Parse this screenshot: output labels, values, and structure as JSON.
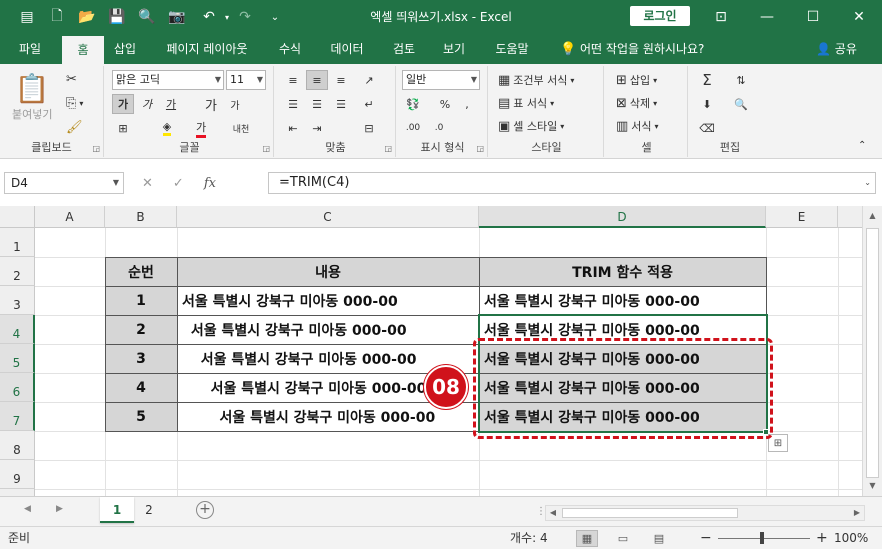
{
  "titlebar": {
    "title": "엑셀 띄워쓰기.xlsx  -  Excel",
    "login": "로그인"
  },
  "tabs": [
    "파일",
    "홈",
    "삽입",
    "페이지 레이아웃",
    "수식",
    "데이터",
    "검토",
    "보기",
    "도움말"
  ],
  "active_tab": "홈",
  "tell_me": "어떤 작업을 원하시나요?",
  "share": "공유",
  "ribbon": {
    "clipboard": {
      "label": "클립보드",
      "paste": "붙여넣기"
    },
    "font": {
      "label": "글꼴",
      "font_name": "맑은 고딕",
      "font_size": "11"
    },
    "alignment": {
      "label": "맞춤"
    },
    "number": {
      "label": "표시 형식",
      "format": "일반"
    },
    "styles": {
      "label": "스타일",
      "conditional": "조건부 서식",
      "table": "표 서식",
      "cell": "셀 스타일"
    },
    "cells": {
      "label": "셀",
      "insert": "삽입",
      "delete": "삭제",
      "format": "서식"
    },
    "editing": {
      "label": "편집"
    }
  },
  "formula_bar": {
    "name_box": "D4",
    "formula": "=TRIM(C4)"
  },
  "columns": [
    "A",
    "B",
    "C",
    "D",
    "E"
  ],
  "rows": [
    "1",
    "2",
    "3",
    "4",
    "5",
    "6",
    "7",
    "8",
    "9"
  ],
  "table": {
    "headers": [
      "순번",
      "내용",
      "TRIM 함수 적용"
    ],
    "rows": [
      {
        "num": "1",
        "content": "서울 특별시 강북구 미아동 000-00",
        "trim": "서울 특별시 강북구 미아동 000-00"
      },
      {
        "num": "2",
        "content": " 서울 특별시 강북구 미아동 000-00",
        "trim": "서울 특별시 강북구 미아동 000-00"
      },
      {
        "num": "3",
        "content": "  서울 특별시 강북구 미아동 000-00",
        "trim": "서울 특별시 강북구 미아동 000-00"
      },
      {
        "num": "4",
        "content": "   서울 특별시 강북구 미아동 000-00",
        "trim": "서울 특별시 강북구 미아동 000-00"
      },
      {
        "num": "5",
        "content": "    서울 특별시 강북구 미아동 000-00",
        "trim": "서울 특별시 강북구 미아동 000-00"
      }
    ]
  },
  "callout": "08",
  "sheets": [
    "1",
    "2"
  ],
  "active_sheet": "1",
  "status": {
    "mode": "준비",
    "count": "개수: 4",
    "zoom": "100%"
  },
  "colors": {
    "accent": "#217346",
    "highlight": "#d0121b",
    "shade": "#d6d6d6"
  }
}
